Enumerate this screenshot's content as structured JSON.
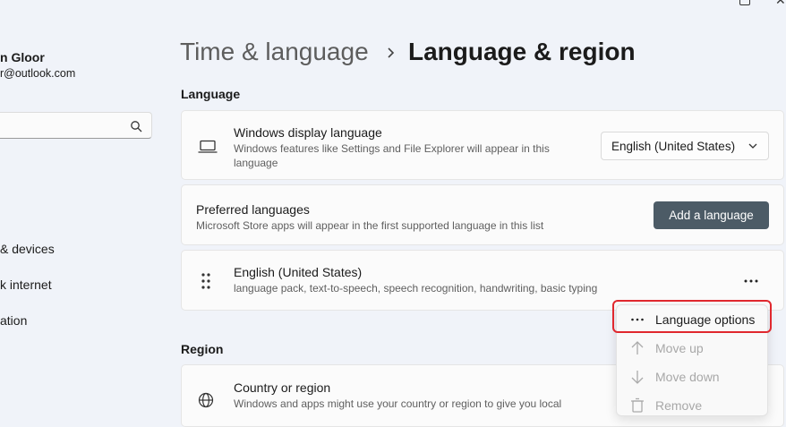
{
  "user": {
    "name": "n Gloor",
    "email": "r@outlook.com"
  },
  "search": {
    "value": "",
    "placeholder": ""
  },
  "sidebar": {
    "items": [
      {
        "label": "& devices"
      },
      {
        "label": "k internet"
      },
      {
        "label": "ation"
      }
    ]
  },
  "header": {
    "parent": "Time & language",
    "current": "Language & region"
  },
  "language_section": {
    "label": "Language",
    "display_language": {
      "title": "Windows display language",
      "description": "Windows features like Settings and File Explorer will appear in this language",
      "selected": "English (United States)"
    },
    "preferred": {
      "title": "Preferred languages",
      "description": "Microsoft Store apps will appear in the first supported language in this list",
      "button": "Add a language"
    },
    "entry": {
      "title": "English (United States)",
      "description": "language pack, text-to-speech, speech recognition, handwriting, basic typing"
    }
  },
  "menu": {
    "items": [
      {
        "label": "Language options",
        "icon": "ellipsis-icon",
        "enabled": true
      },
      {
        "label": "Move up",
        "icon": "arrow-up-icon",
        "enabled": false
      },
      {
        "label": "Move down",
        "icon": "arrow-down-icon",
        "enabled": false
      },
      {
        "label": "Remove",
        "icon": "trash-icon",
        "enabled": false
      }
    ]
  },
  "region_section": {
    "label": "Region",
    "country": {
      "title": "Country or region",
      "description": "Windows and apps might use your country or region to give you local"
    }
  },
  "colors": {
    "accent_button": "#4c5b66",
    "highlight": "#e0282e"
  }
}
